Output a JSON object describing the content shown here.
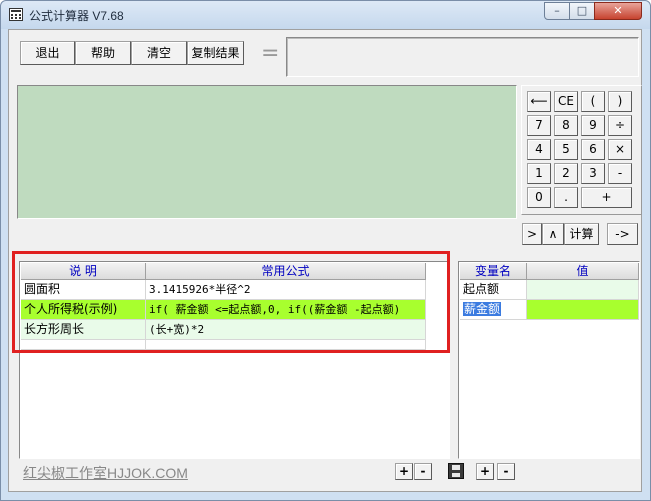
{
  "window": {
    "title": "公式计算器 V7.68",
    "minimize_glyph": "–",
    "maximize_glyph": "□",
    "close_glyph": "✕"
  },
  "toolbar": {
    "exit_label": "退出",
    "help_label": "帮助",
    "clear_label": "清空",
    "copy_label": "复制结果",
    "equals_label": "="
  },
  "keypad": {
    "backspace": "⟵",
    "ce": "CE",
    "lparen": "(",
    "rparen": ")",
    "k7": "7",
    "k8": "8",
    "k9": "9",
    "div": "÷",
    "k4": "4",
    "k5": "5",
    "k6": "6",
    "mul": "×",
    "k1": "1",
    "k2": "2",
    "k3": "3",
    "sub": "-",
    "k0": "0",
    "dot": ".",
    "add": "+"
  },
  "nav": {
    "gt": ">",
    "caret": "∧",
    "calc": "计算",
    "arrow": "->"
  },
  "formulas": {
    "headers": {
      "desc": "说    明",
      "formula": "常用公式"
    },
    "rows": [
      {
        "desc": "圆面积",
        "formula": "3.1415926*半径^2"
      },
      {
        "desc": "个人所得税(示例)",
        "formula": "if( 薪金额 <=起点额,0, if((薪金额 -起点额)"
      },
      {
        "desc": "长方形周长",
        "formula": "(长+宽)*2"
      }
    ]
  },
  "variables": {
    "headers": {
      "name": "变量名",
      "value": "值"
    },
    "rows": [
      {
        "name": "起点额",
        "value": ""
      },
      {
        "name": "薪金额",
        "value": ""
      }
    ]
  },
  "footer": {
    "link": "红尖椒工作室HJJOK.COM",
    "plus1": "+",
    "minus1": "-",
    "plus2": "+",
    "minus2": "-"
  },
  "colors": {
    "display_bg": "#bfdbbf",
    "selected_row": "#a8ff2e",
    "alt_row": "#e9fbe9",
    "annotation_frame": "#e02020"
  },
  "icons": [
    "app-calculator-icon",
    "save-disk-icon"
  ]
}
